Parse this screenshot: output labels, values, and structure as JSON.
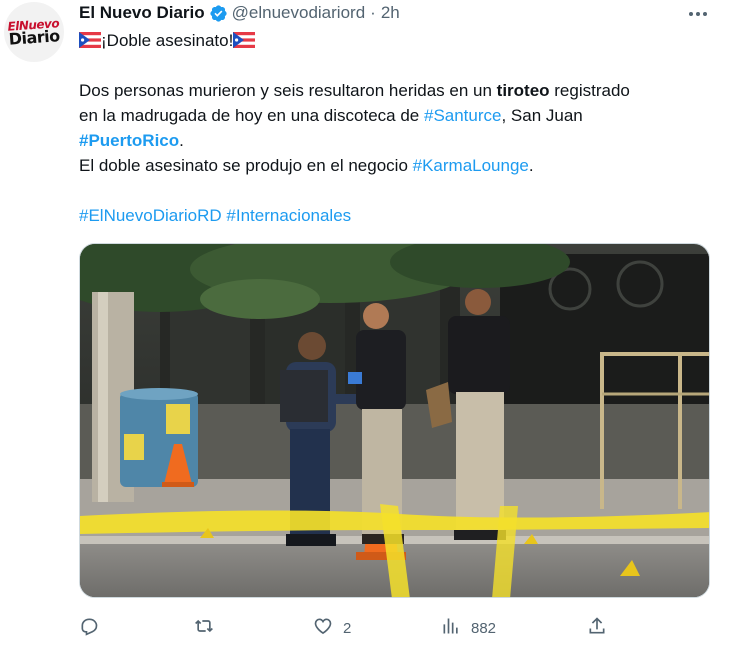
{
  "account": {
    "name": "El Nuevo Diario",
    "handle": "@elnuevodiariord",
    "separator": "·",
    "time": "2h",
    "avatar_lines": [
      "Nuevo",
      "Diario"
    ],
    "avatar_prefix": "El"
  },
  "tweet": {
    "title": "¡Doble asesinato!",
    "line1_a": "Dos personas murieron y seis resultaron heridas en un ",
    "line1_bold": "tiroteo",
    "line1_b": " registrado",
    "line2_a": "en la madrugada de hoy en una discoteca de ",
    "line2_tag": "#Santurce",
    "line2_b": ", San Juan",
    "line3_tag": "#PuertoRico",
    "line3_b": ".",
    "line4_a": "El doble asesinato se produjo en el negocio ",
    "line4_tag": "#KarmaLounge",
    "line4_b": ".",
    "hashtag1": "#ElNuevoDiarioRD",
    "hashtag2": "#Internacionales"
  },
  "image": {
    "alt": "police officers at crime scene behind yellow tape"
  },
  "actions": {
    "reply_count": "",
    "retweet_count": "",
    "like_count": "2",
    "views_count": "882"
  },
  "colors": {
    "accent": "#1d9bf0",
    "text": "#0f1419",
    "muted": "#536471"
  },
  "icons": [
    "verified-badge-icon",
    "more-icon",
    "flag-pr-icon",
    "reply-icon",
    "retweet-icon",
    "like-icon",
    "views-icon",
    "share-icon"
  ]
}
